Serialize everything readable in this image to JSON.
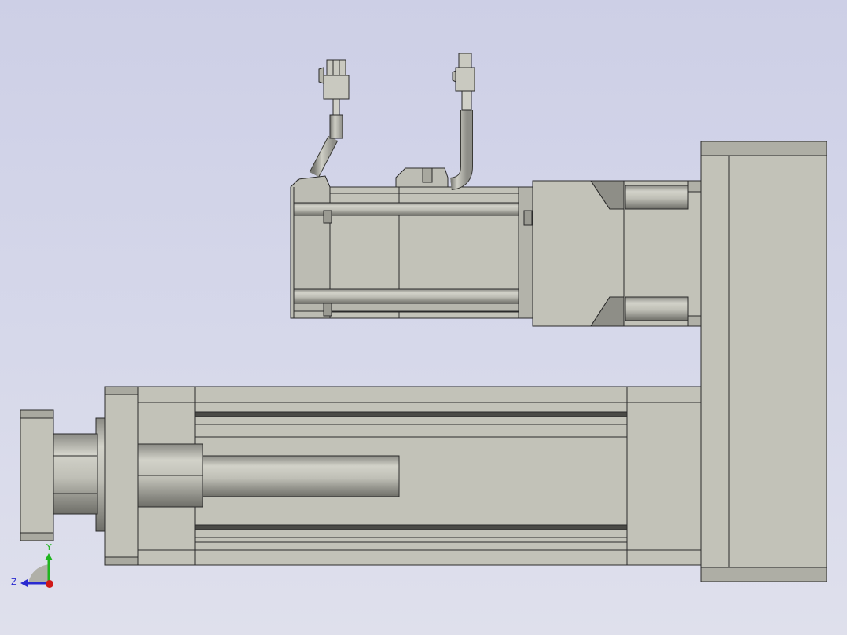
{
  "viewport": {
    "background_top": "#cdcfe6",
    "background_bottom": "#dfe0ec",
    "model_color": "#c2c2b8",
    "edge_color": "#2a2a2a"
  },
  "triad": {
    "y_label": "Y",
    "z_label": "Z",
    "y_color": "#1fb51f",
    "z_color": "#2a2ad0",
    "x_color": "#d01818"
  }
}
